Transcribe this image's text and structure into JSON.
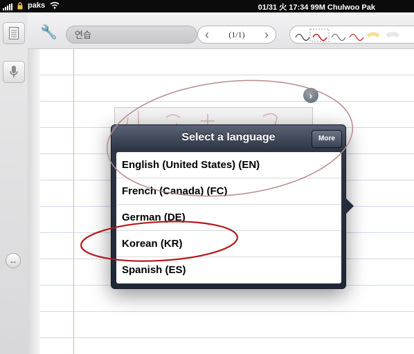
{
  "status_bar": {
    "carrier": "paks",
    "right_text": "01/31 火 17:34 99M Chulwoo Pak"
  },
  "toolbar": {
    "note_title": "연습",
    "page_indicator": "(1/1)",
    "prev_icon": "chevron-left-icon",
    "next_icon": "chevron-right-icon",
    "settings_icon": "wrench-icon"
  },
  "sidebar": {
    "items": [
      {
        "icon": "notes-list-icon"
      },
      {
        "icon": "microphone-icon"
      },
      {
        "icon": "swap-arrows-icon"
      }
    ]
  },
  "popover": {
    "title": "Select a language",
    "more_label": "More",
    "items": [
      {
        "label": "English (United States) (EN)"
      },
      {
        "label": "French (Canada) (FC)"
      },
      {
        "label": "German (DE)"
      },
      {
        "label": "Korean (KR)"
      },
      {
        "label": "Spanish (ES)"
      }
    ]
  },
  "colors": {
    "annotation_red": "#b5171a",
    "popover_dark": "#1f2736"
  }
}
